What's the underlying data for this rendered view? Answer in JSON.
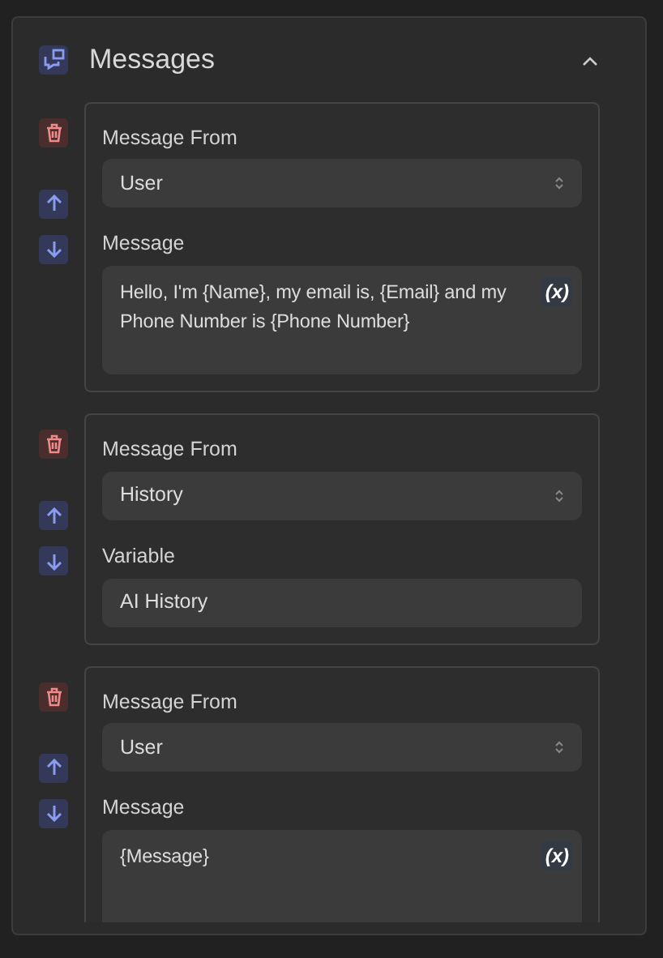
{
  "panel": {
    "title": "Messages",
    "expanded": true
  },
  "messages": [
    {
      "from_label": "Message From",
      "from": "User",
      "kind": "textarea",
      "field_label": "Message",
      "value": "Hello, I'm {Name}, my email is, {Email} and my Phone Number is {Phone Number}",
      "variable_button": "(x)"
    },
    {
      "from_label": "Message From",
      "from": "History",
      "kind": "input",
      "field_label": "Variable",
      "value": "AI History"
    },
    {
      "from_label": "Message From",
      "from": "User",
      "kind": "textarea",
      "field_label": "Message",
      "value": "{Message}",
      "variable_button": "(x)"
    }
  ]
}
